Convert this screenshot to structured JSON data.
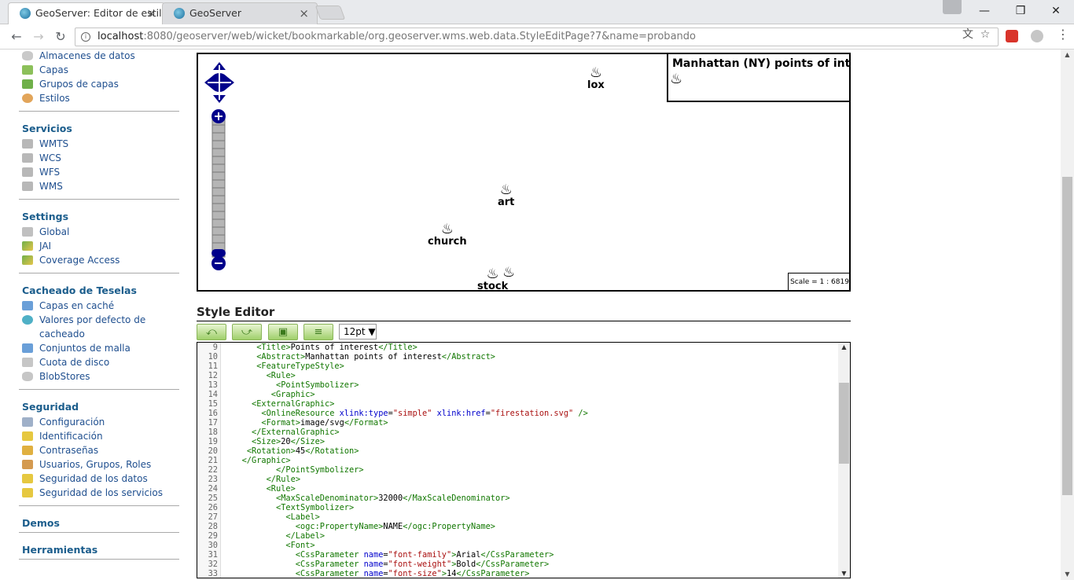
{
  "browser": {
    "tabs": [
      {
        "title": "GeoServer: Editor de estilos",
        "active": true
      },
      {
        "title": "GeoServer",
        "active": false
      }
    ],
    "url_host": "localhost",
    "url_rest": ":8080/geoserver/web/wicket/bookmarkable/org.geoserver.wms.web.data.StyleEditPage?7&name=probando",
    "window_controls": {
      "minimize": "—",
      "maximize": "❒",
      "close": "✕"
    }
  },
  "sidebar": {
    "top_items": [
      {
        "label": "Almacenes de datos",
        "icon": "datastore-icon"
      },
      {
        "label": "Capas",
        "icon": "layers-icon"
      },
      {
        "label": "Grupos de capas",
        "icon": "layer-group-icon"
      },
      {
        "label": "Estilos",
        "icon": "styles-icon"
      }
    ],
    "sections": [
      {
        "title": "Servicios",
        "items": [
          {
            "label": "WMTS",
            "icon": "server-icon"
          },
          {
            "label": "WCS",
            "icon": "server-icon"
          },
          {
            "label": "WFS",
            "icon": "server-icon"
          },
          {
            "label": "WMS",
            "icon": "server-icon"
          }
        ]
      },
      {
        "title": "Settings",
        "items": [
          {
            "label": "Global",
            "icon": "global-settings-icon"
          },
          {
            "label": "JAI",
            "icon": "jai-icon"
          },
          {
            "label": "Coverage Access",
            "icon": "coverage-icon"
          }
        ]
      },
      {
        "title": "Cacheado de Teselas",
        "items": [
          {
            "label": "Capas en caché",
            "icon": "grid-icon"
          },
          {
            "label": "Valores por defecto de cacheado",
            "icon": "globe-icon"
          },
          {
            "label": "Conjuntos de malla",
            "icon": "grid-icon"
          },
          {
            "label": "Cuota de disco",
            "icon": "disk-icon"
          },
          {
            "label": "BlobStores",
            "icon": "blobstore-icon"
          }
        ]
      },
      {
        "title": "Seguridad",
        "items": [
          {
            "label": "Configuración",
            "icon": "wrench-icon"
          },
          {
            "label": "Identificación",
            "icon": "shield-icon"
          },
          {
            "label": "Contraseñas",
            "icon": "lock-icon"
          },
          {
            "label": "Usuarios, Grupos, Roles",
            "icon": "users-icon"
          },
          {
            "label": "Seguridad de los datos",
            "icon": "data-security-icon"
          },
          {
            "label": "Seguridad de los servicios",
            "icon": "service-security-icon"
          }
        ]
      },
      {
        "title": "Demos",
        "items": []
      },
      {
        "title": "Herramientas",
        "items": []
      }
    ]
  },
  "map": {
    "legend_title": "Manhattan (NY) points of intere",
    "scale_text": "Scale = 1 : 6819",
    "points": [
      "lox",
      "art",
      "church",
      "stock"
    ]
  },
  "style_editor": {
    "title": "Style Editor",
    "font_size": "12pt",
    "buttons": [
      "undo-button",
      "redo-button",
      "preview-image-button",
      "format-button"
    ]
  },
  "code_lines": [
    {
      "n": "9",
      "indent": 6,
      "text": "<Title>Points of interest</Title>"
    },
    {
      "n": "10",
      "indent": 6,
      "text": "<Abstract>Manhattan points of interest</Abstract>"
    },
    {
      "n": "11",
      "indent": 6,
      "text": "<FeatureTypeStyle>"
    },
    {
      "n": "12",
      "indent": 8,
      "text": "<Rule>"
    },
    {
      "n": "13",
      "indent": 10,
      "text": "<PointSymbolizer>"
    },
    {
      "n": "14",
      "indent": 9,
      "text": "<Graphic>"
    },
    {
      "n": "15",
      "indent": 5,
      "text": "<ExternalGraphic>"
    },
    {
      "n": "16",
      "indent": 7,
      "text": "<OnlineResource xlink:type=\"simple\" xlink:href=\"firestation.svg\" />"
    },
    {
      "n": "17",
      "indent": 7,
      "text": "<Format>image/svg</Format>"
    },
    {
      "n": "18",
      "indent": 5,
      "text": "</ExternalGraphic>"
    },
    {
      "n": "19",
      "indent": 5,
      "text": "<Size>20</Size>"
    },
    {
      "n": "20",
      "indent": 4,
      "text": "<Rotation>45</Rotation>"
    },
    {
      "n": "21",
      "indent": 3,
      "text": "</Graphic>"
    },
    {
      "n": "22",
      "indent": 10,
      "text": "</PointSymbolizer>"
    },
    {
      "n": "23",
      "indent": 8,
      "text": "</Rule>"
    },
    {
      "n": "24",
      "indent": 8,
      "text": "<Rule>"
    },
    {
      "n": "25",
      "indent": 10,
      "text": "<MaxScaleDenominator>32000</MaxScaleDenominator>"
    },
    {
      "n": "26",
      "indent": 10,
      "text": "<TextSymbolizer>"
    },
    {
      "n": "27",
      "indent": 12,
      "text": "<Label>"
    },
    {
      "n": "28",
      "indent": 14,
      "text": "<ogc:PropertyName>NAME</ogc:PropertyName>"
    },
    {
      "n": "29",
      "indent": 12,
      "text": "</Label>"
    },
    {
      "n": "30",
      "indent": 12,
      "text": "<Font>"
    },
    {
      "n": "31",
      "indent": 14,
      "text": "<CssParameter name=\"font-family\">Arial</CssParameter>"
    },
    {
      "n": "32",
      "indent": 14,
      "text": "<CssParameter name=\"font-weight\">Bold</CssParameter>"
    },
    {
      "n": "33",
      "indent": 14,
      "text": "<CssParameter name=\"font-size\">14</CssParameter>"
    }
  ]
}
